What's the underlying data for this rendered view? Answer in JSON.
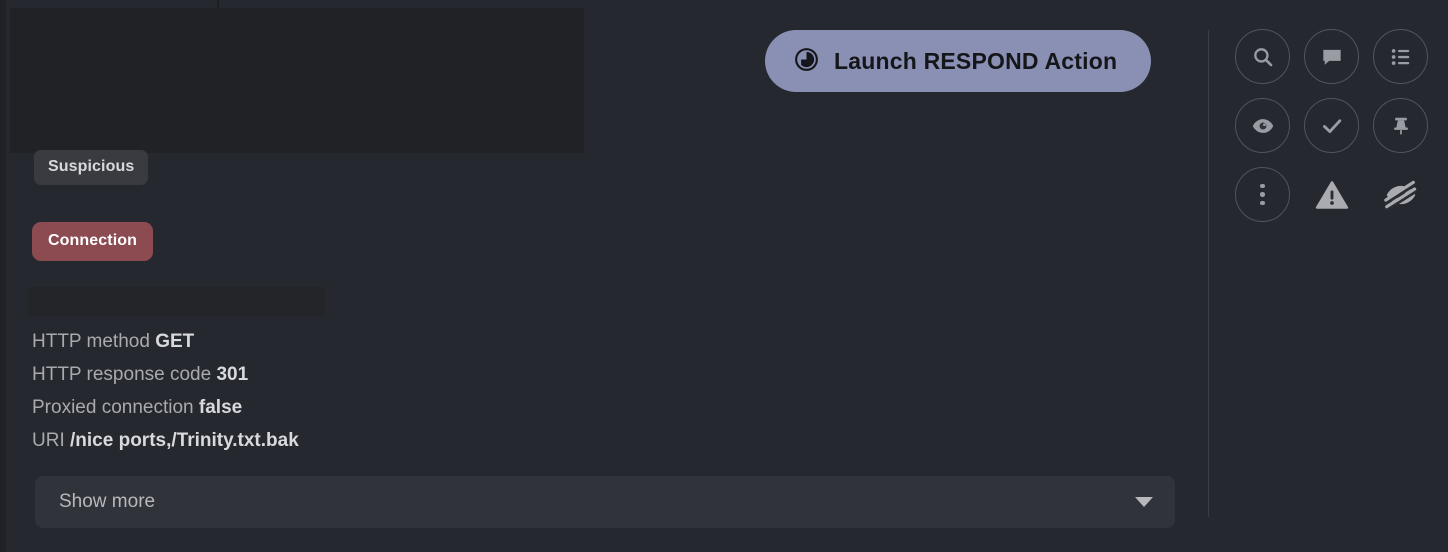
{
  "theme": {
    "background": "#26282f",
    "panel_block": "#212226",
    "accent_button": "#8a90b4",
    "connection_badge": "#8c4a51",
    "suspicious_badge": "#3a3b40",
    "show_more_bar": "#31333a",
    "text_muted": "#a9aab0",
    "text_strong": "#d8d9dd",
    "icon_stroke": "#9a9ca3",
    "divider": "#3b3d44"
  },
  "badges": {
    "classification": "Suspicious",
    "category": "Connection"
  },
  "action_button": {
    "label": "Launch RESPOND Action",
    "icon": "respond-action-icon"
  },
  "details": [
    {
      "key": "HTTP method",
      "value": "GET"
    },
    {
      "key": "HTTP response code",
      "value": "301"
    },
    {
      "key": "Proxied connection",
      "value": "false"
    },
    {
      "key": "URI",
      "value": "/nice ports,/Trinity.txt.bak"
    }
  ],
  "detail_lines": {
    "0_key": "HTTP method",
    "0_value": "GET",
    "1_key": "HTTP response code",
    "1_value": "301",
    "2_key": "Proxied connection",
    "2_value": "false",
    "3_key": "URI",
    "3_value": "/nice ports,/Trinity.txt.bak"
  },
  "show_more": {
    "label": "Show more",
    "caret": "chevron-down-icon"
  },
  "right_rail": {
    "icons": [
      {
        "name": "search-icon",
        "label": "Search",
        "circled": true
      },
      {
        "name": "comment-icon",
        "label": "Comment",
        "circled": true
      },
      {
        "name": "list-icon",
        "label": "List",
        "circled": true
      },
      {
        "name": "eye-icon",
        "label": "Watch",
        "circled": true
      },
      {
        "name": "check-icon",
        "label": "Acknowledge",
        "circled": true
      },
      {
        "name": "pin-icon",
        "label": "Pin",
        "circled": true
      },
      {
        "name": "more-vertical-icon",
        "label": "More options",
        "circled": true
      },
      {
        "name": "warning-icon",
        "label": "Warning",
        "circled": false
      },
      {
        "name": "eye-off-icon",
        "label": "Hide",
        "circled": false
      }
    ]
  }
}
